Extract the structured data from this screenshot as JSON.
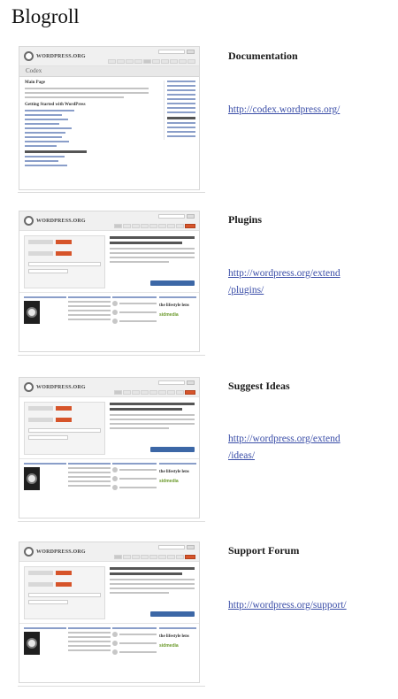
{
  "page": {
    "title": "Blogroll"
  },
  "entries": [
    {
      "title": "Documentation",
      "url_lines": [
        "http://codex.wordpress.org/"
      ],
      "thumb_variant": "codex",
      "thumb_logo_text": "WORDPRESS.ORG",
      "thumb_band_text": "Codex",
      "thumb_heading": "Main Page",
      "thumb_subheading": "Getting Started with WordPress"
    },
    {
      "title": "Plugins",
      "url_lines": [
        "http://wordpress.org/extend",
        "/plugins/"
      ],
      "thumb_variant": "extend",
      "thumb_logo_text": "WORDPRESS.ORG",
      "thumb_logo_a": "the lifestyle lens",
      "thumb_logo_b": "sidmedia"
    },
    {
      "title": "Suggest Ideas",
      "url_lines": [
        "http://wordpress.org/extend",
        "/ideas/"
      ],
      "thumb_variant": "extend",
      "thumb_logo_text": "WORDPRESS.ORG",
      "thumb_logo_a": "the lifestyle lens",
      "thumb_logo_b": "sidmedia"
    },
    {
      "title": "Support Forum",
      "url_lines": [
        "http://wordpress.org/support/"
      ],
      "thumb_variant": "extend",
      "thumb_logo_text": "WORDPRESS.ORG",
      "thumb_logo_a": "the lifestyle lens",
      "thumb_logo_b": "sidmedia"
    }
  ],
  "colors": {
    "link": "#3b4ea8",
    "accent_orange": "#d6542a",
    "button_blue": "#3c67a6"
  }
}
